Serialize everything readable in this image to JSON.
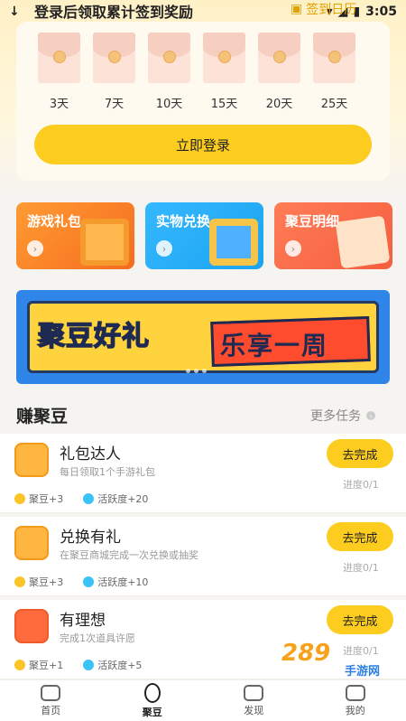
{
  "status_bar": {
    "time": "3:05"
  },
  "signin": {
    "tip": "登录后领取累计签到奖励",
    "calendar_link": "签到日历",
    "days": [
      "3天",
      "7天",
      "10天",
      "15天",
      "20天",
      "25天"
    ],
    "login_button": "立即登录"
  },
  "tiles": [
    {
      "label": "游戏礼包",
      "color": "#f56c1e"
    },
    {
      "label": "实物兑换",
      "color": "#1da4f0"
    },
    {
      "label": "聚豆明细",
      "color": "#f45e3f"
    }
  ],
  "banner": {
    "text_left": "聚豆好礼",
    "text_right": "乐享一周"
  },
  "tasks_section": {
    "title": "赚聚豆",
    "more": "更多任务",
    "tasks": [
      {
        "name": "礼包达人",
        "desc": "每日领取1个手游礼包",
        "beans": "聚豆+3",
        "activity": "活跃度+20",
        "button": "去完成",
        "progress": "进度0/1"
      },
      {
        "name": "兑换有礼",
        "desc": "在聚豆商城完成一次兑换或抽奖",
        "beans": "聚豆+3",
        "activity": "活跃度+10",
        "button": "去完成",
        "progress": "进度0/1"
      },
      {
        "name": "有理想",
        "desc": "完成1次道具许愿",
        "beans": "聚豆+1",
        "activity": "活跃度+5",
        "button": "去完成",
        "progress": "进度0/1"
      }
    ]
  },
  "bottom_nav": [
    {
      "label": "首页",
      "icon": "home-icon"
    },
    {
      "label": "聚豆",
      "icon": "bean-icon",
      "active": true
    },
    {
      "label": "发现",
      "icon": "discover-icon"
    },
    {
      "label": "我的",
      "icon": "profile-icon"
    }
  ],
  "watermark": {
    "main": "289",
    "sub": "手游网"
  },
  "colors": {
    "accent": "#fccd1e",
    "background": "#f6f4f0"
  }
}
